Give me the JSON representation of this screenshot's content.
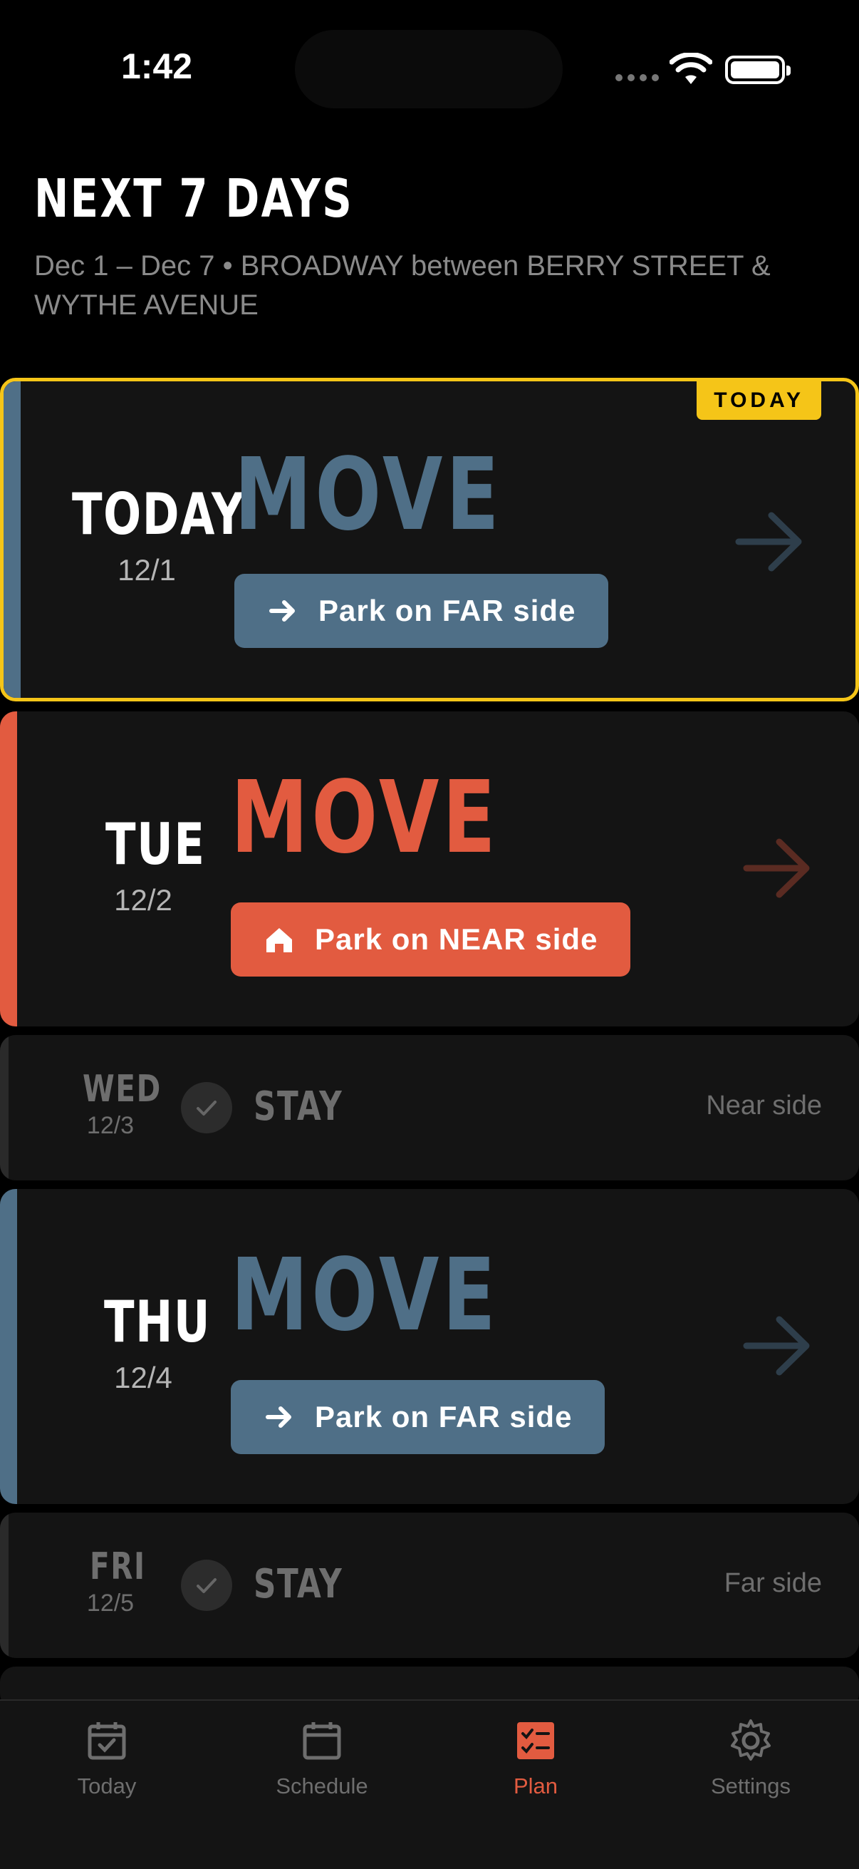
{
  "status_bar": {
    "time": "1:42"
  },
  "header": {
    "title": "NEXT 7 DAYS",
    "subtitle": "Dec 1 – Dec 7 • BROADWAY between BERRY STREET & WYTHE AVENUE"
  },
  "colors": {
    "far": "#4f6f87",
    "near": "#e25b40",
    "today_border": "#f5c518"
  },
  "days": [
    {
      "day": "TODAY",
      "date": "12/1",
      "action": "MOVE",
      "instruction": "Park on FAR side",
      "badge": "TODAY",
      "icon": "arrow-right-icon"
    },
    {
      "day": "TUE",
      "date": "12/2",
      "action": "MOVE",
      "instruction": "Park on NEAR side",
      "icon": "home-icon"
    },
    {
      "day": "WED",
      "date": "12/3",
      "action": "STAY",
      "side": "Near side",
      "icon": "check-icon"
    },
    {
      "day": "THU",
      "date": "12/4",
      "action": "MOVE",
      "instruction": "Park on FAR side",
      "icon": "arrow-right-icon"
    },
    {
      "day": "FRI",
      "date": "12/5",
      "action": "STAY",
      "side": "Far side",
      "icon": "check-icon"
    }
  ],
  "tabs": [
    {
      "label": "Today",
      "icon": "calendar-check-icon"
    },
    {
      "label": "Schedule",
      "icon": "calendar-icon"
    },
    {
      "label": "Plan",
      "icon": "checklist-icon",
      "active": true
    },
    {
      "label": "Settings",
      "icon": "gear-icon"
    }
  ]
}
